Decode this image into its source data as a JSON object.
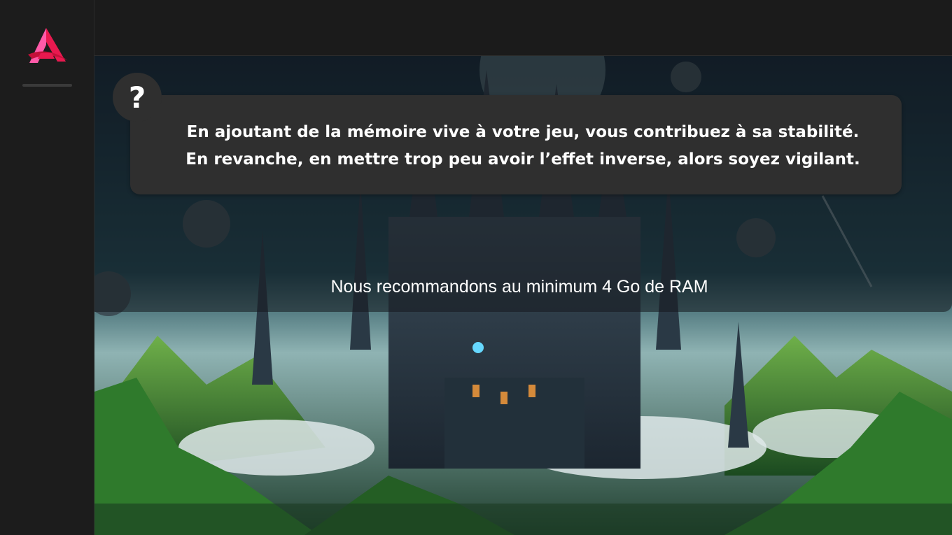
{
  "tip": {
    "help_icon": "question-mark-icon",
    "help_glyph": "?",
    "line1": "En ajoutant de la mémoire vive à votre jeu, vous contribuez à sa stabilité.",
    "line2": "En revanche, en mettre trop peu avoir l’effet inverse, alors soyez vigilant."
  },
  "recommendation": "Nous recommandons au minimum 4 Go de RAM",
  "colors": {
    "logo_primary": "#e8194f",
    "logo_secondary": "#ff5aa8",
    "card": "#2f2f2f",
    "background": "#1b1b1b"
  },
  "logo_icon": "brand-a-logo-icon"
}
